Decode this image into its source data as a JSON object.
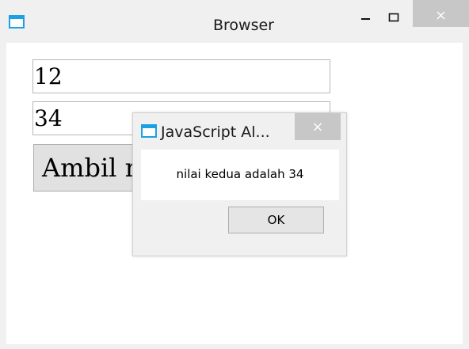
{
  "window": {
    "title": "Browser",
    "controls": {
      "minimize_icon": "minimize-icon",
      "maximize_icon": "maximize-icon",
      "close_icon": "close-icon"
    }
  },
  "form": {
    "first_value": "12",
    "second_value": "34",
    "button_label": "Ambil nilai"
  },
  "alert": {
    "title": "JavaScript Al...",
    "message": "nilai kedua adalah 34",
    "ok_label": "OK"
  },
  "colors": {
    "window_bg": "#f0f0f0",
    "close_bg": "#c7c7c7",
    "icon_blue": "#1ba1e2"
  }
}
